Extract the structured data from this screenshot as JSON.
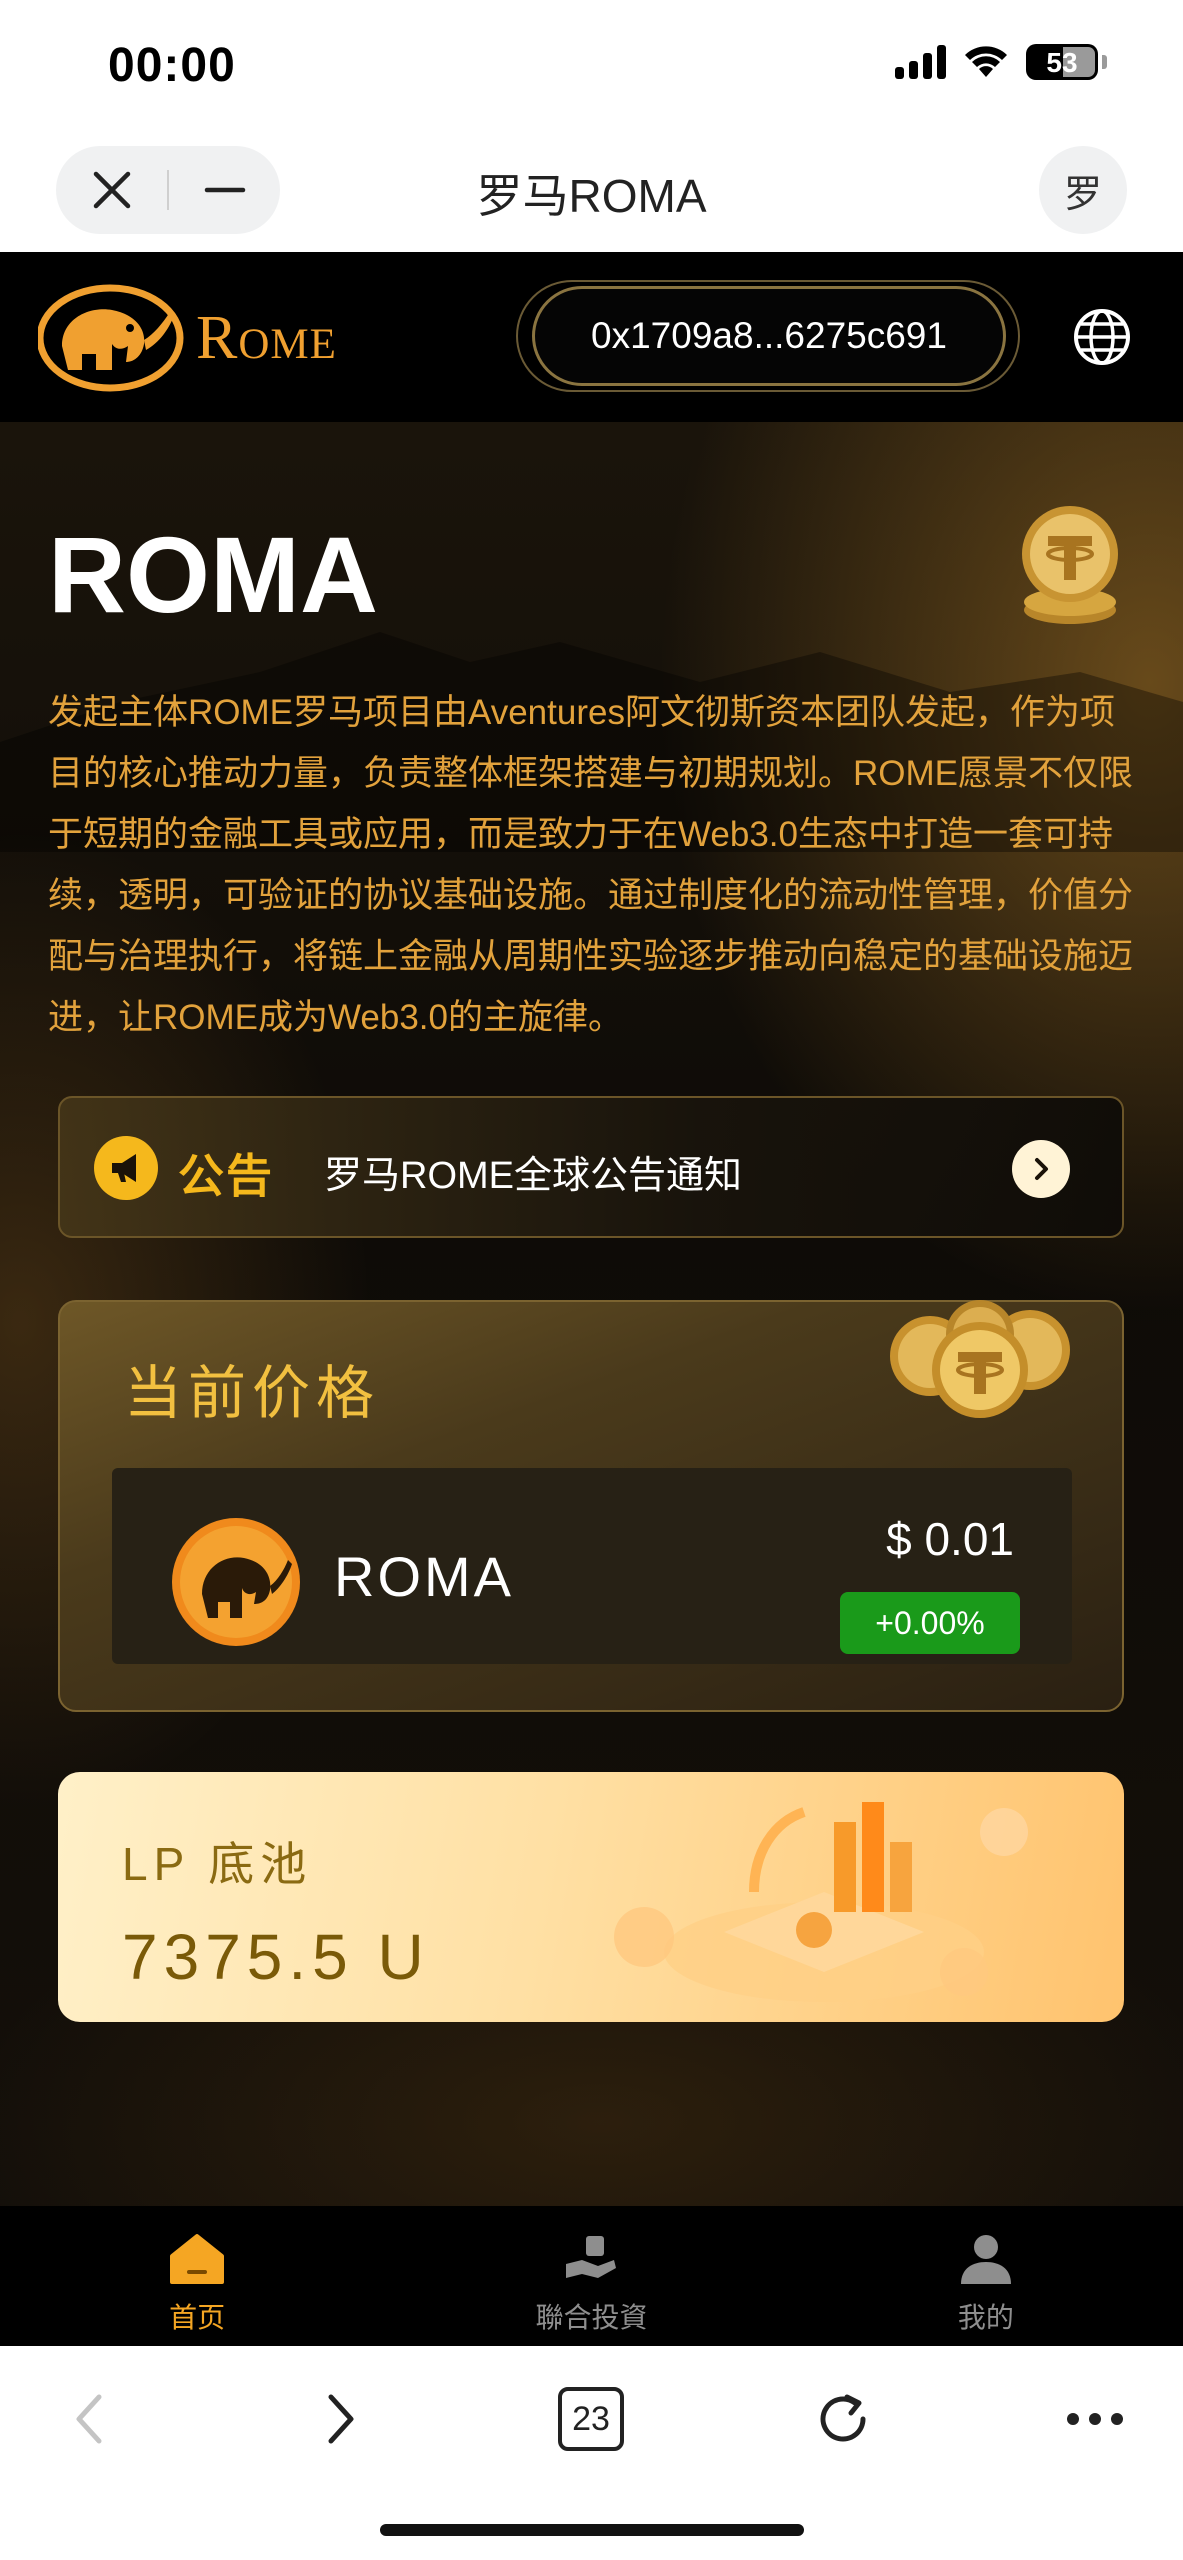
{
  "status_bar": {
    "time": "00:00",
    "battery": "53",
    "icons": [
      "cellular-signal-icon",
      "wifi-icon",
      "battery-icon"
    ]
  },
  "nav_bar": {
    "title": "罗马ROMA",
    "avatar_char": "罗",
    "close_icon": "close-icon",
    "minimize_icon": "minimize-icon"
  },
  "header": {
    "logo_text": "Rome",
    "wallet_address": "0x1709a8...6275c691",
    "language_icon": "globe-icon"
  },
  "hero": {
    "title": "ROMA",
    "description": "发起主体ROME罗马项目由Aventures阿文彻斯资本团队发起，作为项目的核心推动力量，负责整体框架搭建与初期规划。ROME愿景不仅限于短期的金融工具或应用，而是致力于在Web3.0生态中打造一套可持续，透明，可验证的协议基础设施。通过制度化的流动性管理，价值分配与治理执行，将链上金融从周期性实验逐步推动向稳定的基础设施迈进，让ROME成为Web3.0的主旋律。"
  },
  "notice": {
    "tag": "公告",
    "text": "罗马ROME全球公告通知",
    "icon": "megaphone-icon",
    "arrow_icon": "chevron-right-icon"
  },
  "price": {
    "label": "当前价格",
    "token_name": "ROMA",
    "value": "$ 0.01",
    "change": "+0.00%",
    "change_color": "#1a9a1a"
  },
  "lp_pool": {
    "label": "LP 底池",
    "value": "7375.5 U"
  },
  "tabs": [
    {
      "label": "首页",
      "icon": "home-icon",
      "active": true
    },
    {
      "label": "聯合投資",
      "icon": "invest-icon",
      "active": false
    },
    {
      "label": "我的",
      "icon": "profile-icon",
      "active": false
    }
  ],
  "toolbar": {
    "tab_count": "23",
    "icons": [
      "back-icon",
      "forward-icon",
      "tabs-icon",
      "reload-icon",
      "more-icon"
    ]
  },
  "colors": {
    "accent": "#f5a623",
    "gold_text": "#e2a23c",
    "background": "#0c0a07"
  }
}
